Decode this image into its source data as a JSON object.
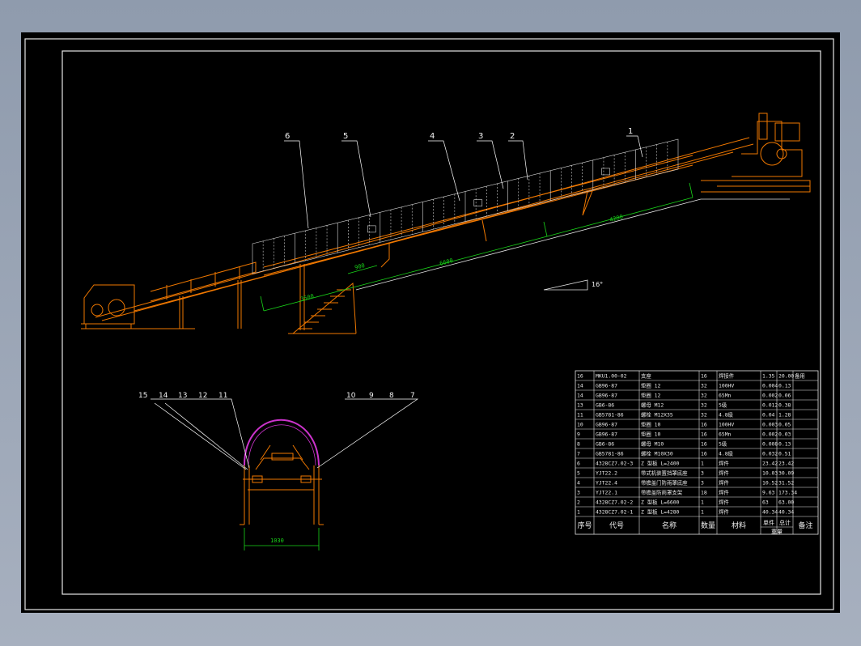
{
  "callouts_main": [
    "6",
    "5",
    "4",
    "3",
    "2",
    "1"
  ],
  "callouts_section_left": [
    "15",
    "14",
    "13",
    "12",
    "11"
  ],
  "callouts_section_right": [
    "10",
    "9",
    "8",
    "7"
  ],
  "dimensions": {
    "section_width": "1030",
    "main_span_1": "6600",
    "main_span_2": "4280",
    "main_span_3": "3500",
    "main_short": "900"
  },
  "slope_label": "16°",
  "bom": {
    "headers": [
      "序号",
      "代号",
      "名称",
      "数量",
      "材料",
      "单件",
      "总计",
      "备注"
    ],
    "headers_sub": "重量",
    "rows": [
      [
        "16",
        "MKU1.00-02",
        "支座",
        "16",
        "焊接件",
        "1.35",
        "20.00",
        "备用"
      ],
      [
        "14",
        "GB96-87",
        "垫圈 12",
        "32",
        "100HV",
        "0.004",
        "0.13",
        ""
      ],
      [
        "14",
        "GB96-87",
        "垫圈 12",
        "32",
        "65Mn",
        "0.002",
        "0.06",
        ""
      ],
      [
        "13",
        "GB6-86",
        "螺母 M12",
        "32",
        "5级",
        "0.012",
        "0.38",
        ""
      ],
      [
        "11",
        "GB5781-86",
        "螺栓 M12X35",
        "32",
        "4.8级",
        "0.04",
        "1.28",
        ""
      ],
      [
        "10",
        "GB96-87",
        "垫圈 10",
        "16",
        "100HV",
        "0.003",
        "0.05",
        ""
      ],
      [
        "9",
        "GB96-87",
        "垫圈 10",
        "16",
        "65Mn",
        "0.002",
        "0.03",
        ""
      ],
      [
        "8",
        "GB6-86",
        "螺母 M10",
        "16",
        "5级",
        "0.008",
        "0.13",
        ""
      ],
      [
        "7",
        "GB5781-86",
        "螺栓 M10X30",
        "16",
        "4.8级",
        "0.032",
        "0.51",
        ""
      ],
      [
        "6",
        "4328CZ7.02-3",
        "Z 型板 L=2400",
        "1",
        "焊件",
        "23.42",
        "23.42",
        ""
      ],
      [
        "5",
        "YJT22.2",
        "带式机装置挡罩底座",
        "3",
        "焊件",
        "10.03",
        "30.09",
        ""
      ],
      [
        "4",
        "YJT22.4",
        "带檐盖门防雨罩底座",
        "3",
        "焊件",
        "10.52",
        "31.52",
        ""
      ],
      [
        "3",
        "YJT22.1",
        "带檐盖防雨罩支架",
        "18",
        "焊件",
        "9.63",
        "173.34",
        ""
      ],
      [
        "2",
        "4328CZ7.02-2",
        "Z 型板 L=6600",
        "1",
        "焊件",
        "63",
        "63.00",
        ""
      ],
      [
        "1",
        "4328CZ7.02-1",
        "Z 型板 L=4280",
        "1",
        "焊件",
        "40.34",
        "40.34",
        ""
      ]
    ]
  },
  "colors": {
    "frame": "#e6e6e6",
    "structure": "#f07800",
    "cover_grid": "#d8d8d8",
    "dimension": "#19d419",
    "rain_cover_arc": "#cc33cc",
    "callout_line": "#ffffff"
  }
}
